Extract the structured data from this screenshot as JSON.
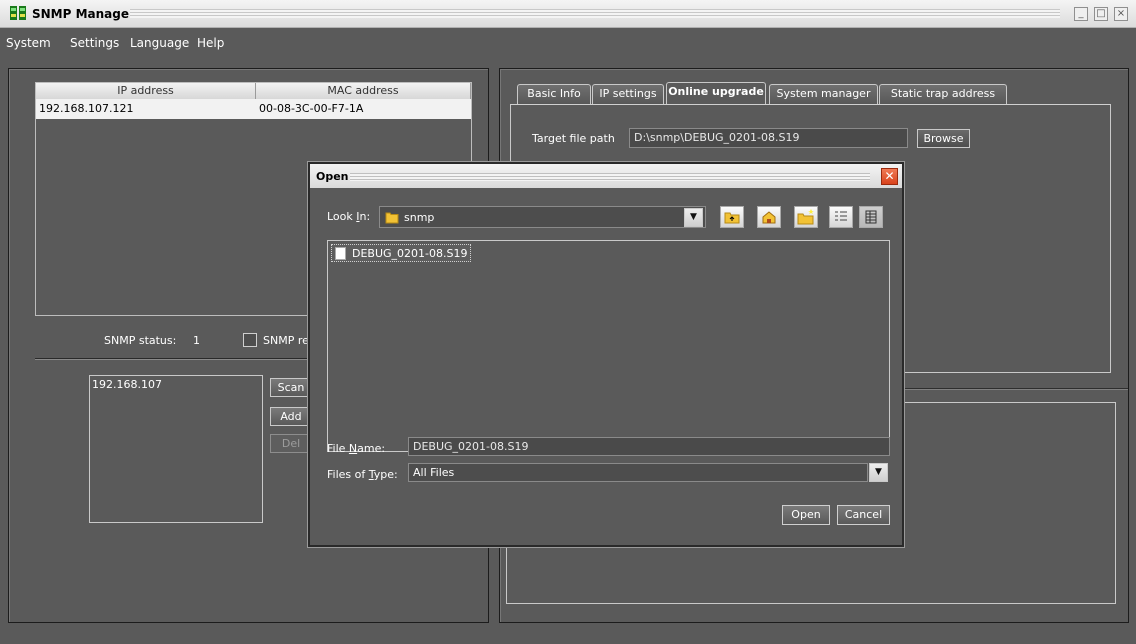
{
  "window": {
    "title": "SNMP Manager"
  },
  "menu": [
    "System",
    "Settings",
    "Language",
    "Help"
  ],
  "device_table": {
    "columns": [
      "IP address",
      "MAC address"
    ],
    "rows": [
      {
        "ip": "192.168.107.121",
        "mac": "00-08-3C-00-F7-1A"
      }
    ]
  },
  "status": {
    "label": "SNMP status:",
    "value": "1",
    "checkbox_label": "SNMP re"
  },
  "scan": {
    "networks": [
      "192.168.107"
    ],
    "buttons": {
      "scan": "Scan",
      "add": "Add",
      "del": "Del"
    }
  },
  "tabs": [
    "Basic Info",
    "IP settings",
    "Online upgrade",
    "System manager",
    "Static trap address"
  ],
  "active_tab": "Online upgrade",
  "upgrade": {
    "target_label": "Target file path",
    "target_value": "D:\\snmp\\DEBUG_0201-08.S19",
    "browse_label": "Browse"
  },
  "dialog": {
    "title": "Open",
    "look_in_label": "Look In:",
    "look_in_value": "snmp",
    "files": [
      "DEBUG_0201-08.S19"
    ],
    "file_name_label": "File Name:",
    "file_name_value": "DEBUG_0201-08.S19",
    "file_type_label": "Files of Type:",
    "file_type_value": "All Files",
    "open_button": "Open",
    "cancel_button": "Cancel"
  },
  "colors": {
    "background": "#5a5a5a",
    "selected_row": "#f2f2f2",
    "folder": "#f2c235",
    "close": "#e0502a"
  }
}
